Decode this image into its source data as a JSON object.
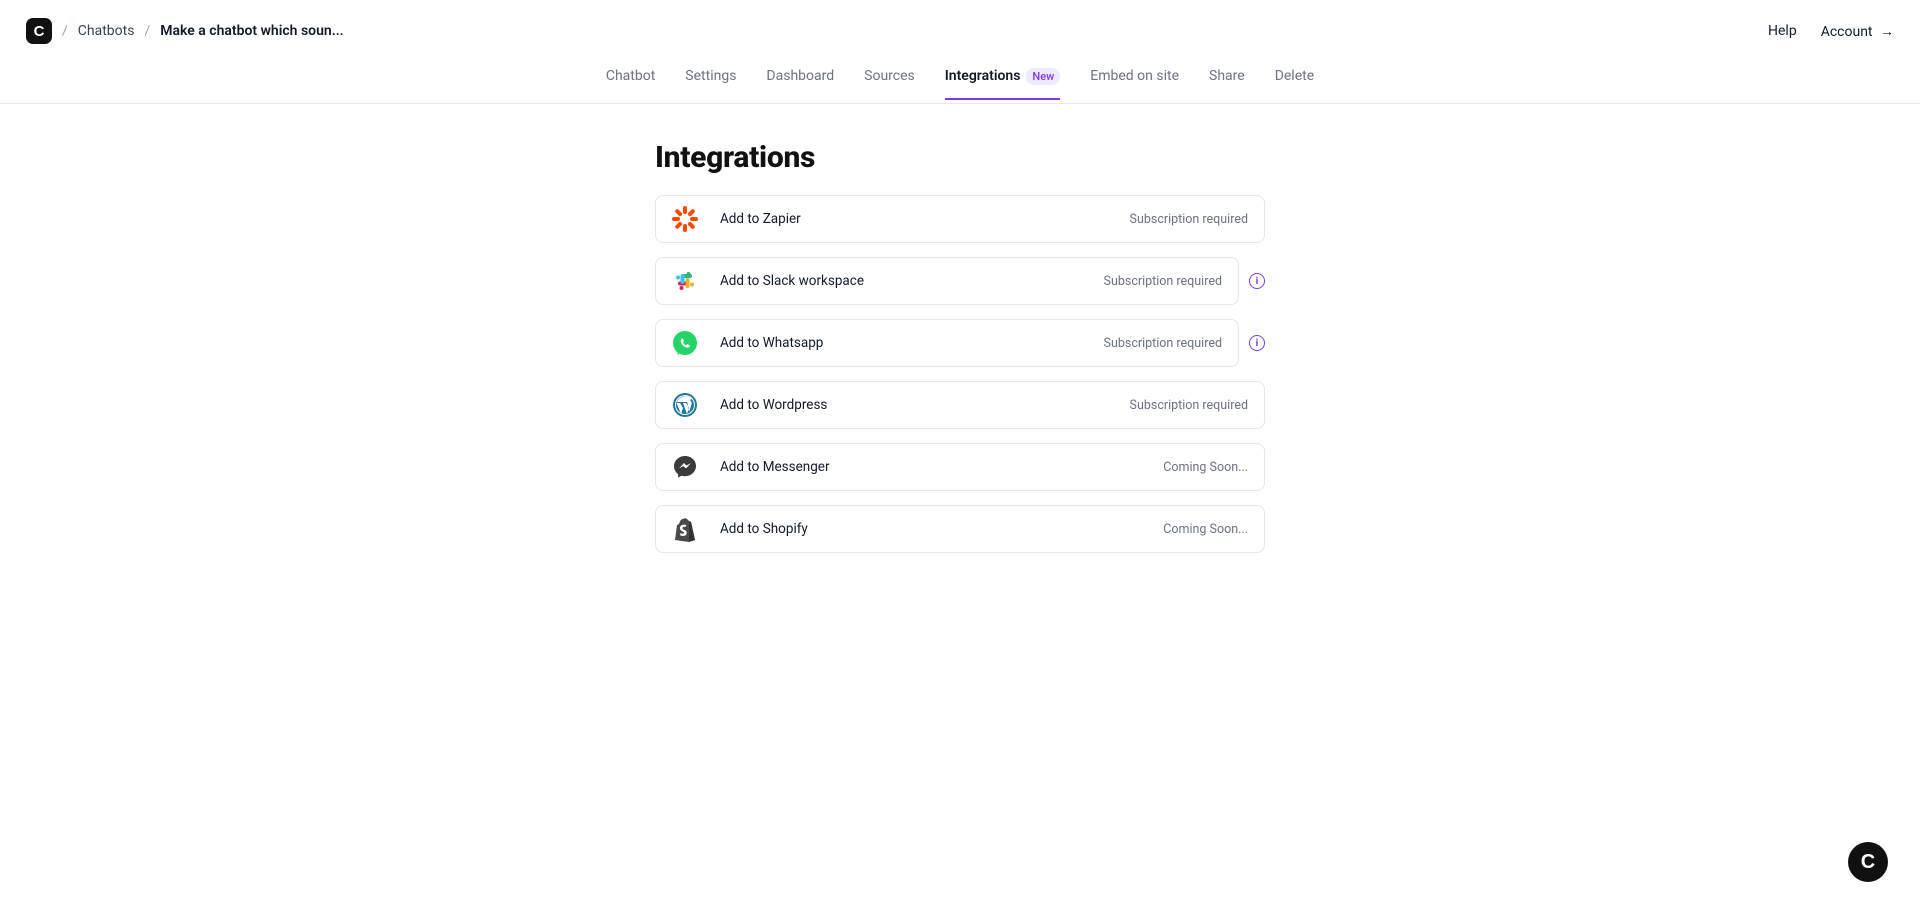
{
  "breadcrumb": {
    "root": "Chatbots",
    "current": "Make a chatbot which soun..."
  },
  "header": {
    "help": "Help",
    "account": "Account",
    "account_arrow": "→"
  },
  "tabs": [
    {
      "label": "Chatbot"
    },
    {
      "label": "Settings"
    },
    {
      "label": "Dashboard"
    },
    {
      "label": "Sources"
    },
    {
      "label": "Integrations",
      "badge": "New",
      "active": true
    },
    {
      "label": "Embed on site"
    },
    {
      "label": "Share"
    },
    {
      "label": "Delete"
    }
  ],
  "page": {
    "title": "Integrations"
  },
  "integrations": [
    {
      "label": "Add to Zapier",
      "status": "Subscription required",
      "info": false,
      "icon": "zapier"
    },
    {
      "label": "Add to Slack workspace",
      "status": "Subscription required",
      "info": true,
      "icon": "slack"
    },
    {
      "label": "Add to Whatsapp",
      "status": "Subscription required",
      "info": true,
      "icon": "whatsapp"
    },
    {
      "label": "Add to Wordpress",
      "status": "Subscription required",
      "info": false,
      "icon": "wordpress"
    },
    {
      "label": "Add to Messenger",
      "status": "Coming Soon...",
      "info": false,
      "icon": "messenger"
    },
    {
      "label": "Add to Shopify",
      "status": "Coming Soon...",
      "info": false,
      "icon": "shopify"
    }
  ]
}
